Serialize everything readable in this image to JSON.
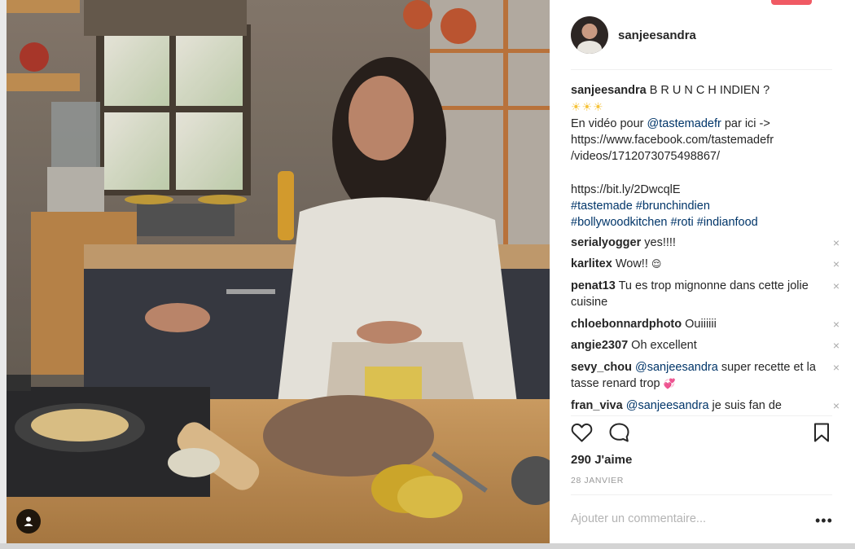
{
  "post": {
    "username": "sanjeesandra",
    "caption": {
      "username": "sanjeesandra",
      "line1": "B R U N C H INDIEN ?",
      "suns": "☀☀☀",
      "line2_prefix": "En vidéo pour ",
      "line2_mention": "@tastemadefr",
      "line2_suffix": " par ici ->",
      "url1": "https://www.facebook.com/tastemadefr",
      "url2": "/videos/1712073075498867/",
      "short_link": "https://bit.ly/2DwcqlE",
      "hashtags1": "#tastemade #brunchindien",
      "hashtags2": "#bollywoodkitchen #roti #indianfood"
    },
    "comments": [
      {
        "user": "serialyogger",
        "text": "yes!!!!"
      },
      {
        "user": "karlitex",
        "text": "Wow!!",
        "emoji": "😌"
      },
      {
        "user": "penat13",
        "text": "Tu es trop mignonne dans cette jolie cuisine"
      },
      {
        "user": "chloebonnardphoto",
        "text": "Ouiiiiii"
      },
      {
        "user": "angie2307",
        "text": "Oh excellent"
      },
      {
        "user": "sevy_chou",
        "mention": "@sanjeesandra",
        "text": " super recette et la tasse renard trop",
        "emoji": "💞"
      },
      {
        "user": "fran_viva",
        "mention": "@sanjeesandra",
        "text": " je suis fan de"
      }
    ],
    "likes": "290 J'aime",
    "date": "28 JANVIER",
    "add_comment_placeholder": "Ajouter un commentaire...",
    "more_label": "•••",
    "remove_label": "×"
  },
  "icons": {
    "like": "heart-icon",
    "comment": "comment-bubble-icon",
    "save": "bookmark-icon",
    "user_tag": "person-tag-icon"
  },
  "colors": {
    "link": "#003569",
    "accent": "#f05a64",
    "muted": "#999999"
  }
}
